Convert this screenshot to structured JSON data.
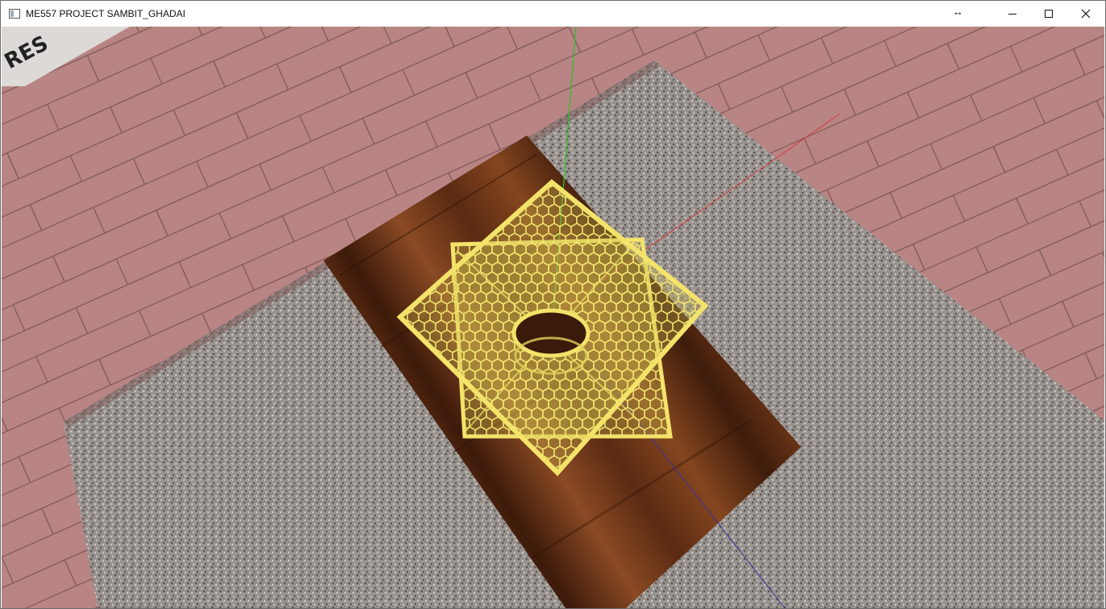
{
  "window": {
    "title": "ME557 PROJECT SAMBIT_GHADAI",
    "controls": {
      "minimize": "minimize",
      "maximize": "maximize",
      "close": "close"
    }
  },
  "scene": {
    "corner_sign_text": "RES",
    "colors": {
      "wall": "#b88584",
      "carpet": "#9a9491",
      "wood": "#6a3418",
      "lattice": "#e5d65f",
      "x_axis": "#d63a3a",
      "y_axis": "#2fbf2f",
      "z_axis": "#3a2f9a"
    }
  }
}
